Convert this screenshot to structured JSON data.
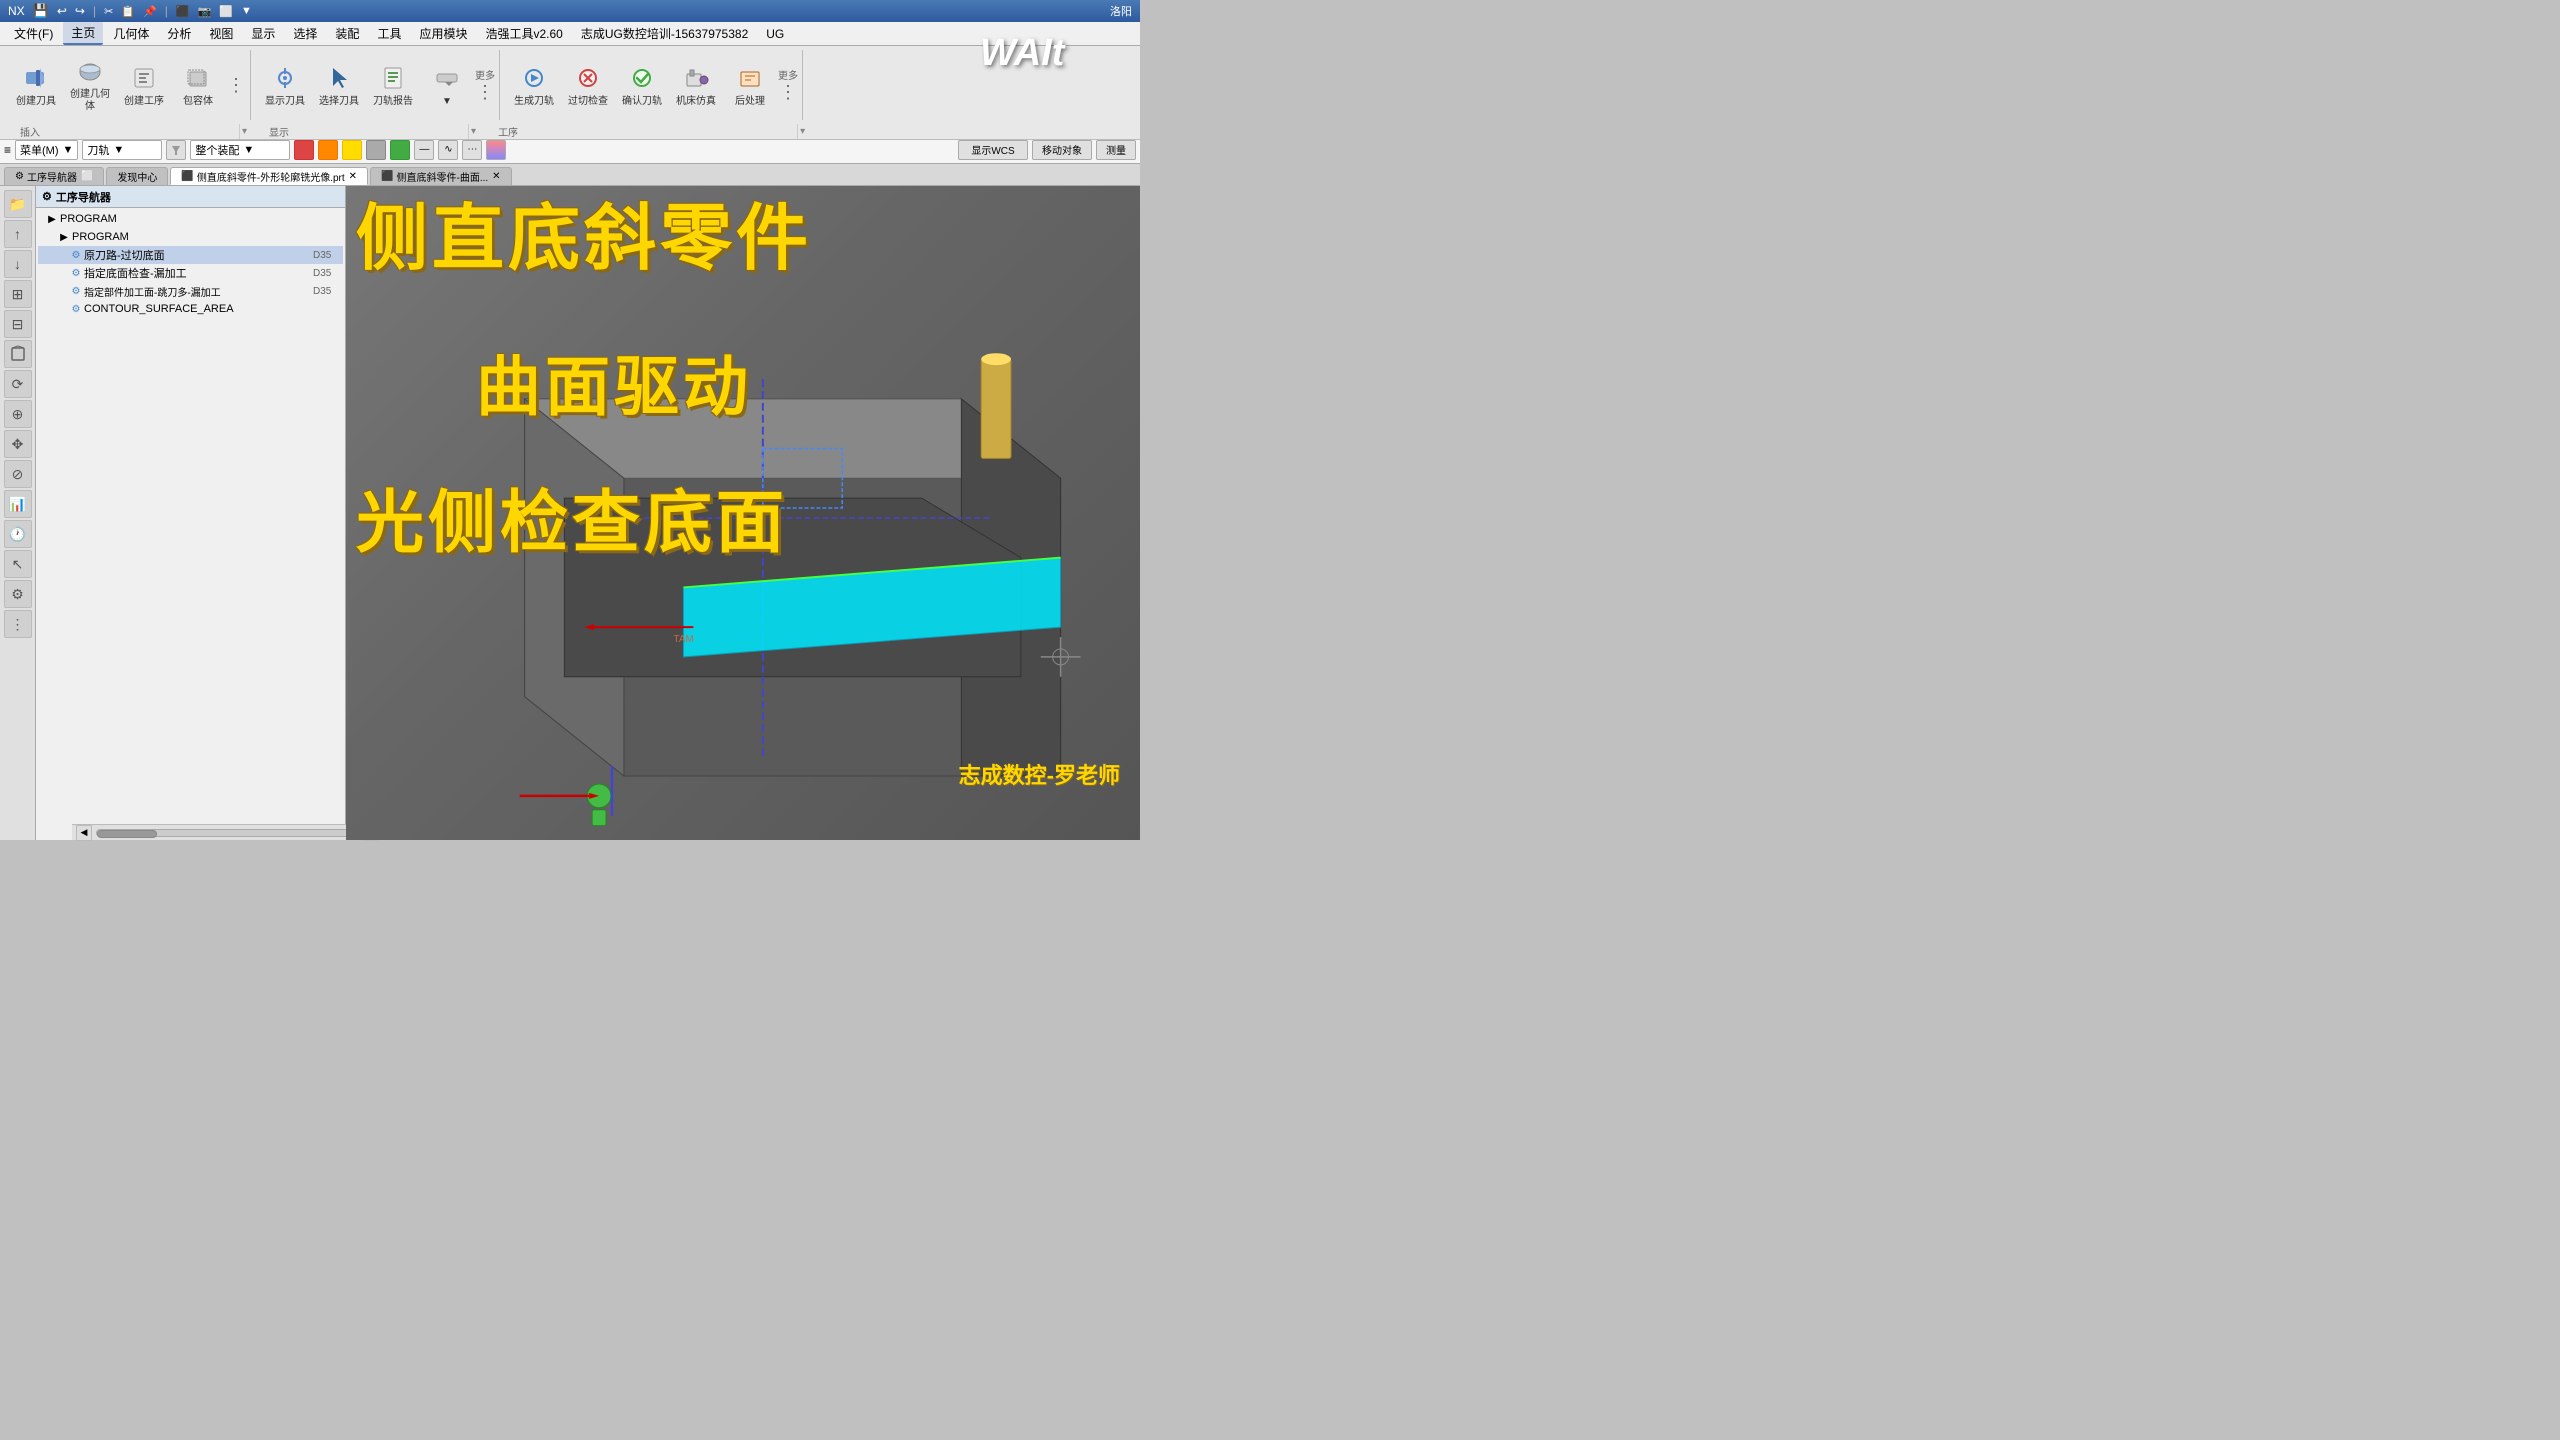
{
  "window": {
    "title": "NX",
    "company": "洛阳"
  },
  "title_bar": {
    "app_name": "NX",
    "icons": [
      "save-icon",
      "undo-icon",
      "redo-icon",
      "cut-icon",
      "copy-icon",
      "paste-icon",
      "record-icon",
      "camera-icon",
      "more-icon"
    ],
    "right_text": "洛阳"
  },
  "menu": {
    "items": [
      "文件(F)",
      "主页",
      "几何体",
      "分析",
      "视图",
      "显示",
      "选择",
      "装配",
      "工具",
      "应用模块",
      "浩强工具v2.60",
      "志成UG数控培训-15637975382",
      "UG"
    ]
  },
  "toolbar": {
    "insert_group_label": "插入",
    "display_group_label": "显示",
    "operation_group_label": "工序",
    "buttons": [
      {
        "id": "create-tool",
        "label": "创建刀具",
        "icon": "blade-icon"
      },
      {
        "id": "create-geom",
        "label": "创建几何体",
        "icon": "solid-icon"
      },
      {
        "id": "create-op",
        "label": "创建工序",
        "icon": "text-op-icon"
      },
      {
        "id": "container",
        "label": "包容体",
        "icon": "box-icon"
      },
      {
        "id": "show-tool",
        "label": "显示刀具",
        "icon": "view-icon"
      },
      {
        "id": "select-tool",
        "label": "选择刀具",
        "icon": "select-icon"
      },
      {
        "id": "nc-report",
        "label": "刀轨报告",
        "icon": "report-icon"
      },
      {
        "id": "more-display",
        "label": "更多",
        "icon": "more-icon"
      },
      {
        "id": "gen-tool",
        "label": "生成刀轨",
        "icon": "gen-icon"
      },
      {
        "id": "over-cut",
        "label": "过切检查",
        "icon": "cut-icon"
      },
      {
        "id": "confirm-tool",
        "label": "确认刀轨",
        "icon": "confirm-icon"
      },
      {
        "id": "machine-sim",
        "label": "机床仿真",
        "icon": "machine-icon"
      },
      {
        "id": "post-proc",
        "label": "后处理",
        "icon": "post-icon"
      },
      {
        "id": "more-op",
        "label": "更多",
        "icon": "more-icon"
      }
    ]
  },
  "cmd_bar": {
    "menu_label": "菜单(M)",
    "dropdown1": "刀轨",
    "dropdown2": "整个装配",
    "wcs_btn": "显示WCS",
    "move_btn": "移动对象",
    "measure_btn": "测量"
  },
  "tabs": {
    "items": [
      {
        "label": "工序导航器",
        "active": false
      },
      {
        "label": "发现中心",
        "active": false
      },
      {
        "label": "侧直底斜零件-外形轮廓铣光像.prt",
        "active": true
      },
      {
        "label": "侧直底斜零件-曲面...",
        "active": false
      }
    ]
  },
  "navigator": {
    "title": "工序导航器",
    "tree_items": [
      {
        "level": 0,
        "label": "PROGRAM",
        "icon": "▶",
        "badge": ""
      },
      {
        "level": 1,
        "label": "PROGRAM",
        "icon": "▶",
        "badge": ""
      },
      {
        "level": 2,
        "label": "原刀路-过切底面",
        "icon": "⚙",
        "badge": "D35"
      },
      {
        "level": 2,
        "label": "指定底面检查-漏加工",
        "icon": "⚙",
        "badge": "D35"
      },
      {
        "level": 2,
        "label": "指定部件加工面-跳刀多-漏加工",
        "icon": "⚙",
        "badge": "D35"
      },
      {
        "level": 2,
        "label": "CONTOUR_SURFACE_AREA",
        "icon": "⚙",
        "badge": ""
      }
    ]
  },
  "viewport": {
    "background_color": "#777777",
    "model_color": "#666666"
  },
  "overlay": {
    "line1": "侧直底斜零件",
    "line2": "曲面驱动",
    "line3": "光侧检查底面",
    "watermark": "志成数控-罗老师",
    "wait_text": "WAIt"
  },
  "sidebar_icons": [
    "resource-icon",
    "arrow-up-icon",
    "arrow-down-icon",
    "grid-icon",
    "list-icon",
    "cube-icon",
    "rotate-icon",
    "zoom-icon",
    "pan-icon",
    "section-icon",
    "analyze-icon",
    "clock-icon",
    "pointer-icon",
    "settings-icon",
    "more2-icon"
  ]
}
